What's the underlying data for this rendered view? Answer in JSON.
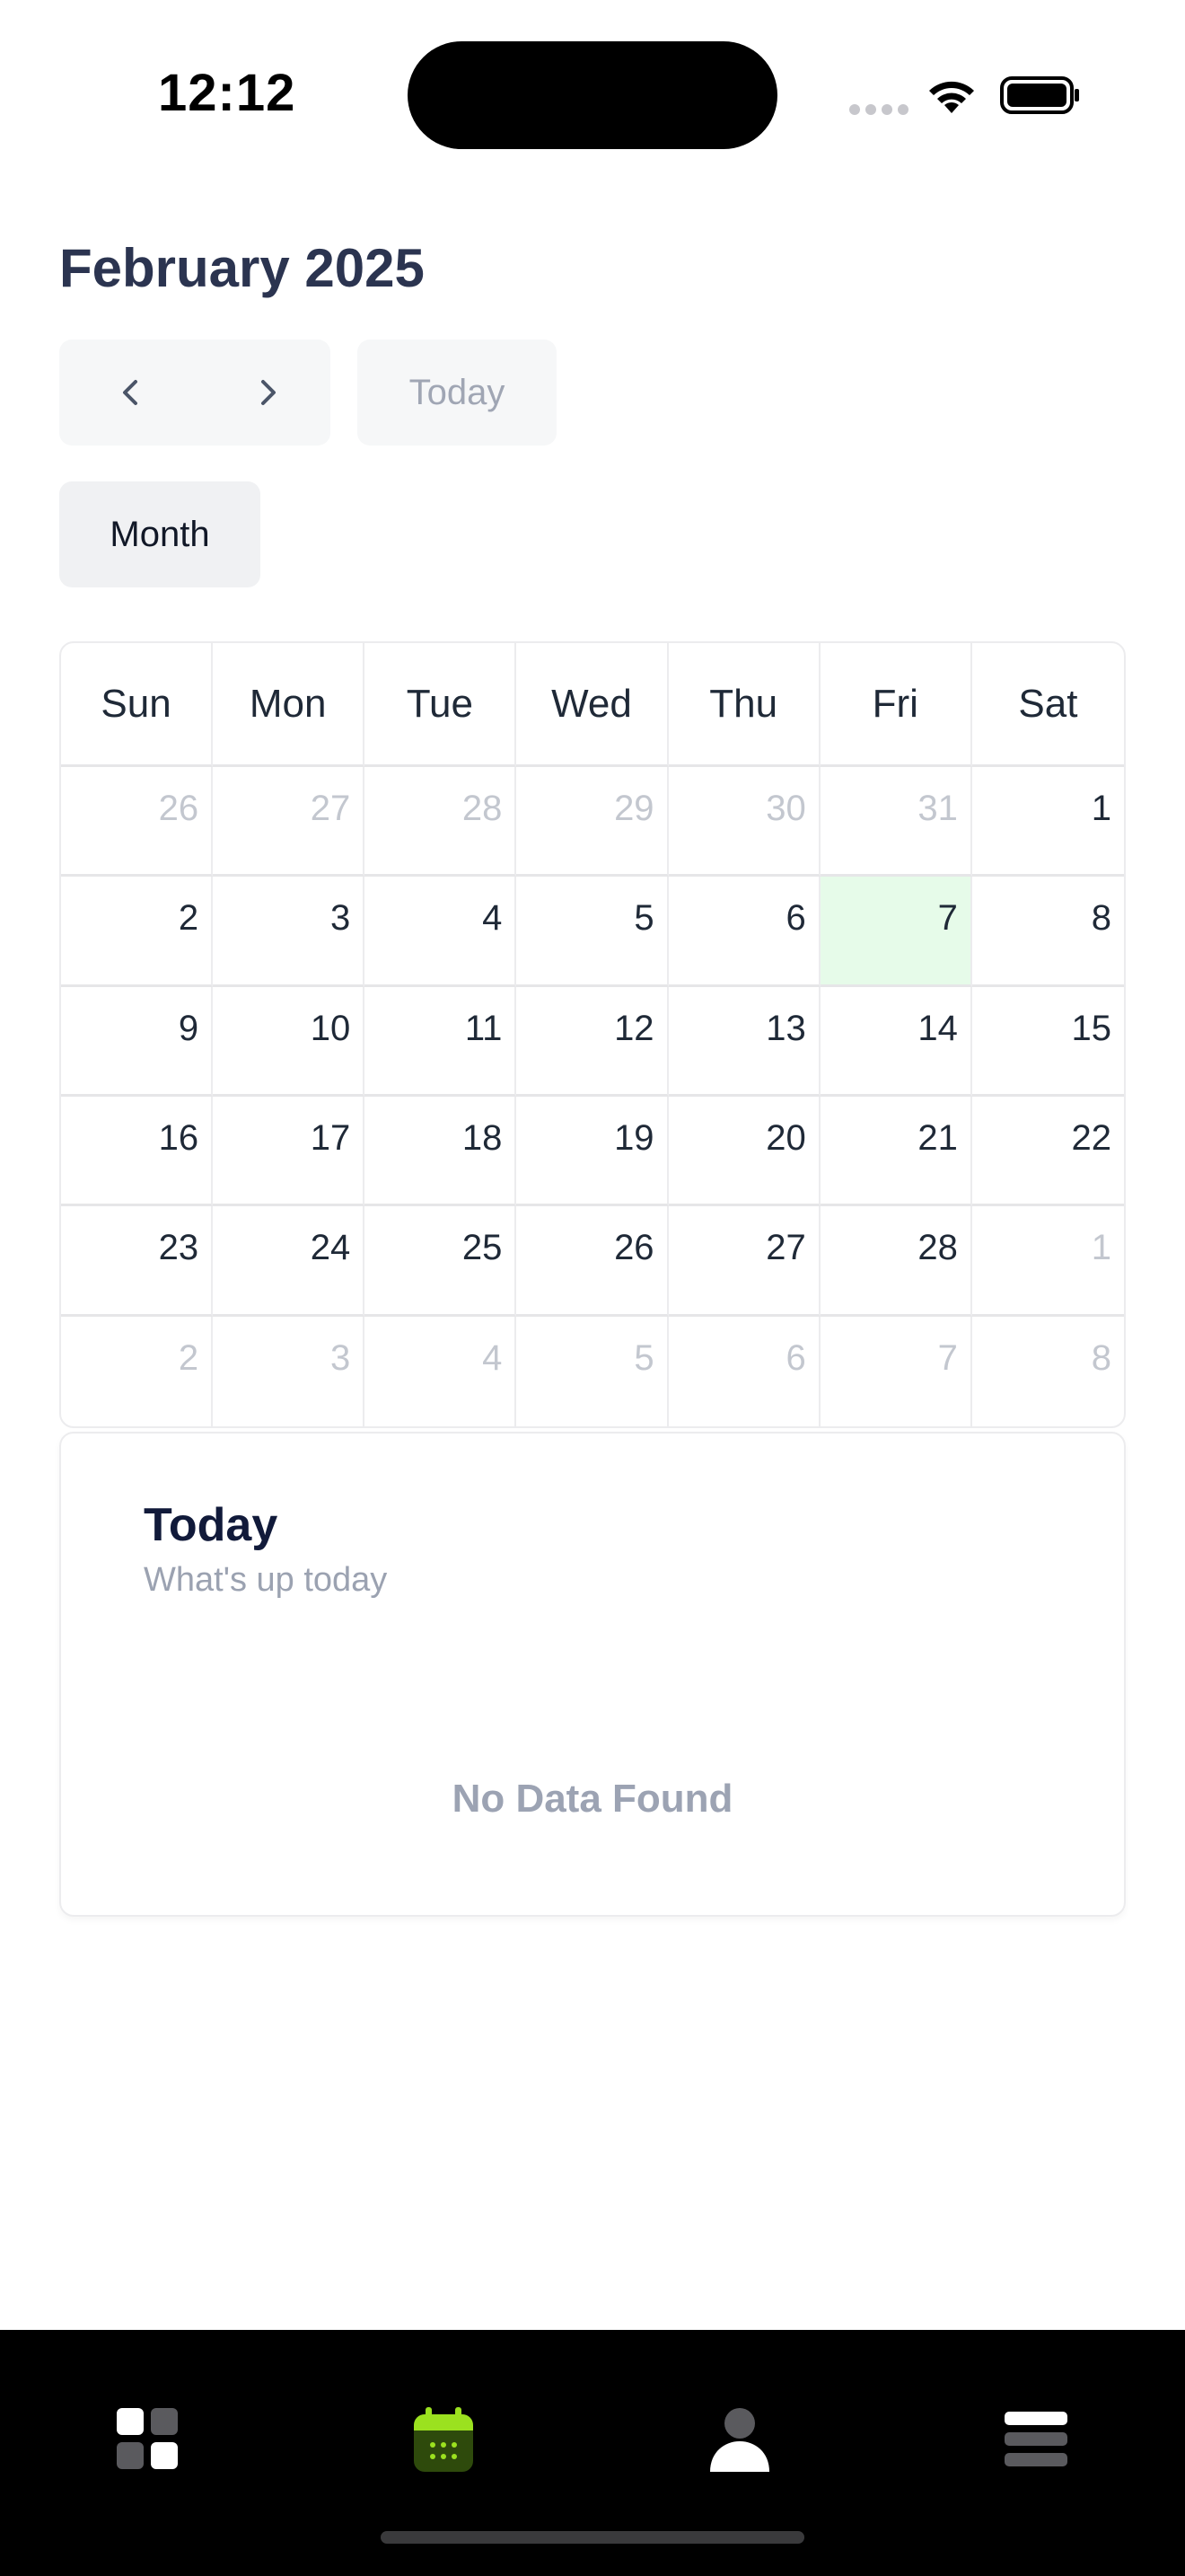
{
  "status_bar": {
    "time": "12:12"
  },
  "header": {
    "month_title": "February 2025"
  },
  "toolbar": {
    "prev_icon": "chevron-left-icon",
    "next_icon": "chevron-right-icon",
    "today_label": "Today",
    "view_label": "Month"
  },
  "calendar": {
    "weekdays": [
      "Sun",
      "Mon",
      "Tue",
      "Wed",
      "Thu",
      "Fri",
      "Sat"
    ],
    "selected_day": "7",
    "days": [
      {
        "label": "26",
        "muted": true
      },
      {
        "label": "27",
        "muted": true
      },
      {
        "label": "28",
        "muted": true
      },
      {
        "label": "29",
        "muted": true
      },
      {
        "label": "30",
        "muted": true
      },
      {
        "label": "31",
        "muted": true
      },
      {
        "label": "1",
        "muted": false
      },
      {
        "label": "2",
        "muted": false
      },
      {
        "label": "3",
        "muted": false
      },
      {
        "label": "4",
        "muted": false
      },
      {
        "label": "5",
        "muted": false
      },
      {
        "label": "6",
        "muted": false
      },
      {
        "label": "7",
        "muted": false,
        "selected": true
      },
      {
        "label": "8",
        "muted": false
      },
      {
        "label": "9",
        "muted": false
      },
      {
        "label": "10",
        "muted": false
      },
      {
        "label": "11",
        "muted": false
      },
      {
        "label": "12",
        "muted": false
      },
      {
        "label": "13",
        "muted": false
      },
      {
        "label": "14",
        "muted": false
      },
      {
        "label": "15",
        "muted": false
      },
      {
        "label": "16",
        "muted": false
      },
      {
        "label": "17",
        "muted": false
      },
      {
        "label": "18",
        "muted": false
      },
      {
        "label": "19",
        "muted": false
      },
      {
        "label": "20",
        "muted": false
      },
      {
        "label": "21",
        "muted": false
      },
      {
        "label": "22",
        "muted": false
      },
      {
        "label": "23",
        "muted": false
      },
      {
        "label": "24",
        "muted": false
      },
      {
        "label": "25",
        "muted": false
      },
      {
        "label": "26",
        "muted": false
      },
      {
        "label": "27",
        "muted": false
      },
      {
        "label": "28",
        "muted": false
      },
      {
        "label": "1",
        "muted": true
      },
      {
        "label": "2",
        "muted": true
      },
      {
        "label": "3",
        "muted": true
      },
      {
        "label": "4",
        "muted": true
      },
      {
        "label": "5",
        "muted": true
      },
      {
        "label": "6",
        "muted": true
      },
      {
        "label": "7",
        "muted": true
      },
      {
        "label": "8",
        "muted": true
      }
    ]
  },
  "today_panel": {
    "title": "Today",
    "subtitle": "What's up today",
    "empty_text": "No Data Found"
  },
  "tab_bar": {
    "active_color": "#9be11f",
    "items": [
      {
        "icon": "dashboard-grid-icon",
        "active": false
      },
      {
        "icon": "calendar-icon",
        "active": true
      },
      {
        "icon": "user-icon",
        "active": false
      },
      {
        "icon": "menu-lines-icon",
        "active": false
      }
    ]
  },
  "colors": {
    "selected_day_bg": "#e6fbe9",
    "title": "#2b3450",
    "muted": "#c3c7cf"
  }
}
